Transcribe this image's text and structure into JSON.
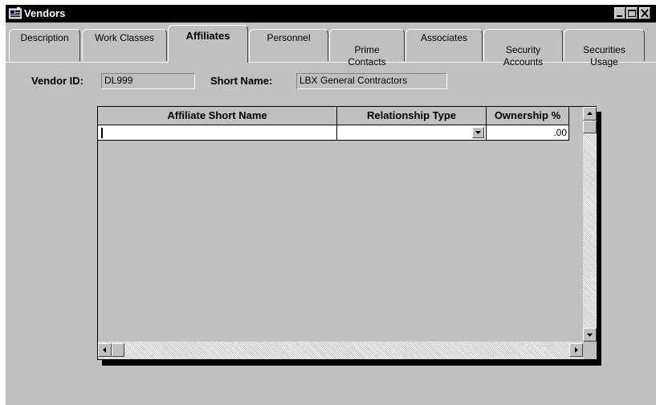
{
  "window": {
    "title": "Vendors"
  },
  "tabs": [
    {
      "label": "Description"
    },
    {
      "label": "Work Classes"
    },
    {
      "label": "Affiliates",
      "active": true
    },
    {
      "label": "Personnel"
    },
    {
      "label": "Prime\nContacts"
    },
    {
      "label": "Associates"
    },
    {
      "label": "Security\nAccounts"
    },
    {
      "label": "Securities\nUsage"
    }
  ],
  "form": {
    "vendor_id_label": "Vendor ID:",
    "vendor_id_value": "DL999",
    "short_name_label": "Short Name:",
    "short_name_value": "LBX General Contractors"
  },
  "grid": {
    "columns": [
      "Affiliate Short Name",
      "Relationship Type",
      "Ownership %"
    ],
    "rows": [
      {
        "affiliate_short_name": "",
        "relationship_type": "",
        "ownership_pct": ".00"
      }
    ]
  }
}
